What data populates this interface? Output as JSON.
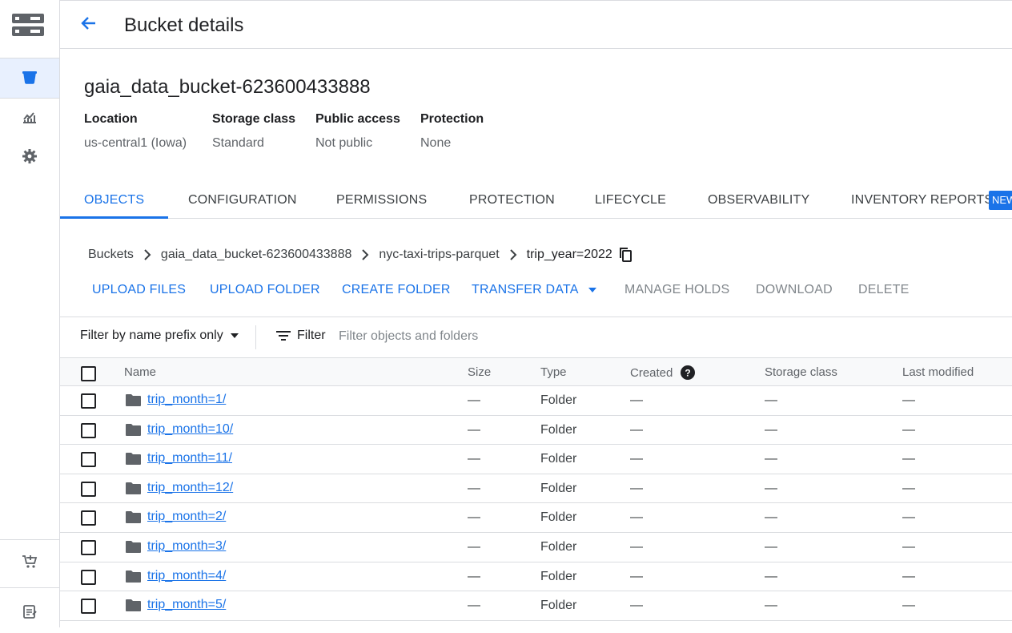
{
  "header": {
    "title": "Bucket details"
  },
  "bucket": {
    "name": "gaia_data_bucket-623600433888",
    "meta": [
      {
        "label": "Location",
        "value": "us-central1 (Iowa)"
      },
      {
        "label": "Storage class",
        "value": "Standard"
      },
      {
        "label": "Public access",
        "value": "Not public"
      },
      {
        "label": "Protection",
        "value": "None"
      }
    ]
  },
  "tabs": [
    {
      "label": "OBJECTS",
      "active": true
    },
    {
      "label": "CONFIGURATION"
    },
    {
      "label": "PERMISSIONS"
    },
    {
      "label": "PROTECTION"
    },
    {
      "label": "LIFECYCLE"
    },
    {
      "label": "OBSERVABILITY"
    },
    {
      "label": "INVENTORY REPORTS"
    }
  ],
  "new_badge": "NEW",
  "breadcrumb": [
    "Buckets",
    "gaia_data_bucket-623600433888",
    "nyc-taxi-trips-parquet",
    "trip_year=2022"
  ],
  "actions": {
    "upload_files": "UPLOAD FILES",
    "upload_folder": "UPLOAD FOLDER",
    "create_folder": "CREATE FOLDER",
    "transfer_data": "TRANSFER DATA",
    "manage_holds": "MANAGE HOLDS",
    "download": "DOWNLOAD",
    "delete": "DELETE"
  },
  "filter": {
    "prefix_label": "Filter by name prefix only",
    "filter_label": "Filter",
    "placeholder": "Filter objects and folders"
  },
  "table": {
    "columns": [
      "Name",
      "Size",
      "Type",
      "Created",
      "Storage class",
      "Last modified"
    ],
    "rows": [
      {
        "name": "trip_month=1/",
        "size": "—",
        "type": "Folder",
        "created": "—",
        "storage_class": "—",
        "last_modified": "—"
      },
      {
        "name": "trip_month=10/",
        "size": "—",
        "type": "Folder",
        "created": "—",
        "storage_class": "—",
        "last_modified": "—"
      },
      {
        "name": "trip_month=11/",
        "size": "—",
        "type": "Folder",
        "created": "—",
        "storage_class": "—",
        "last_modified": "—"
      },
      {
        "name": "trip_month=12/",
        "size": "—",
        "type": "Folder",
        "created": "—",
        "storage_class": "—",
        "last_modified": "—"
      },
      {
        "name": "trip_month=2/",
        "size": "—",
        "type": "Folder",
        "created": "—",
        "storage_class": "—",
        "last_modified": "—"
      },
      {
        "name": "trip_month=3/",
        "size": "—",
        "type": "Folder",
        "created": "—",
        "storage_class": "—",
        "last_modified": "—"
      },
      {
        "name": "trip_month=4/",
        "size": "—",
        "type": "Folder",
        "created": "—",
        "storage_class": "—",
        "last_modified": "—"
      },
      {
        "name": "trip_month=5/",
        "size": "—",
        "type": "Folder",
        "created": "—",
        "storage_class": "—",
        "last_modified": "—"
      }
    ]
  },
  "rail_icons": [
    "storage-logo-icon",
    "bucket-icon",
    "monitoring-icon",
    "settings-icon",
    "marketplace-icon",
    "release-notes-icon"
  ],
  "colors": {
    "accent": "#1a73e8",
    "active_bg": "#e8f0fe"
  }
}
